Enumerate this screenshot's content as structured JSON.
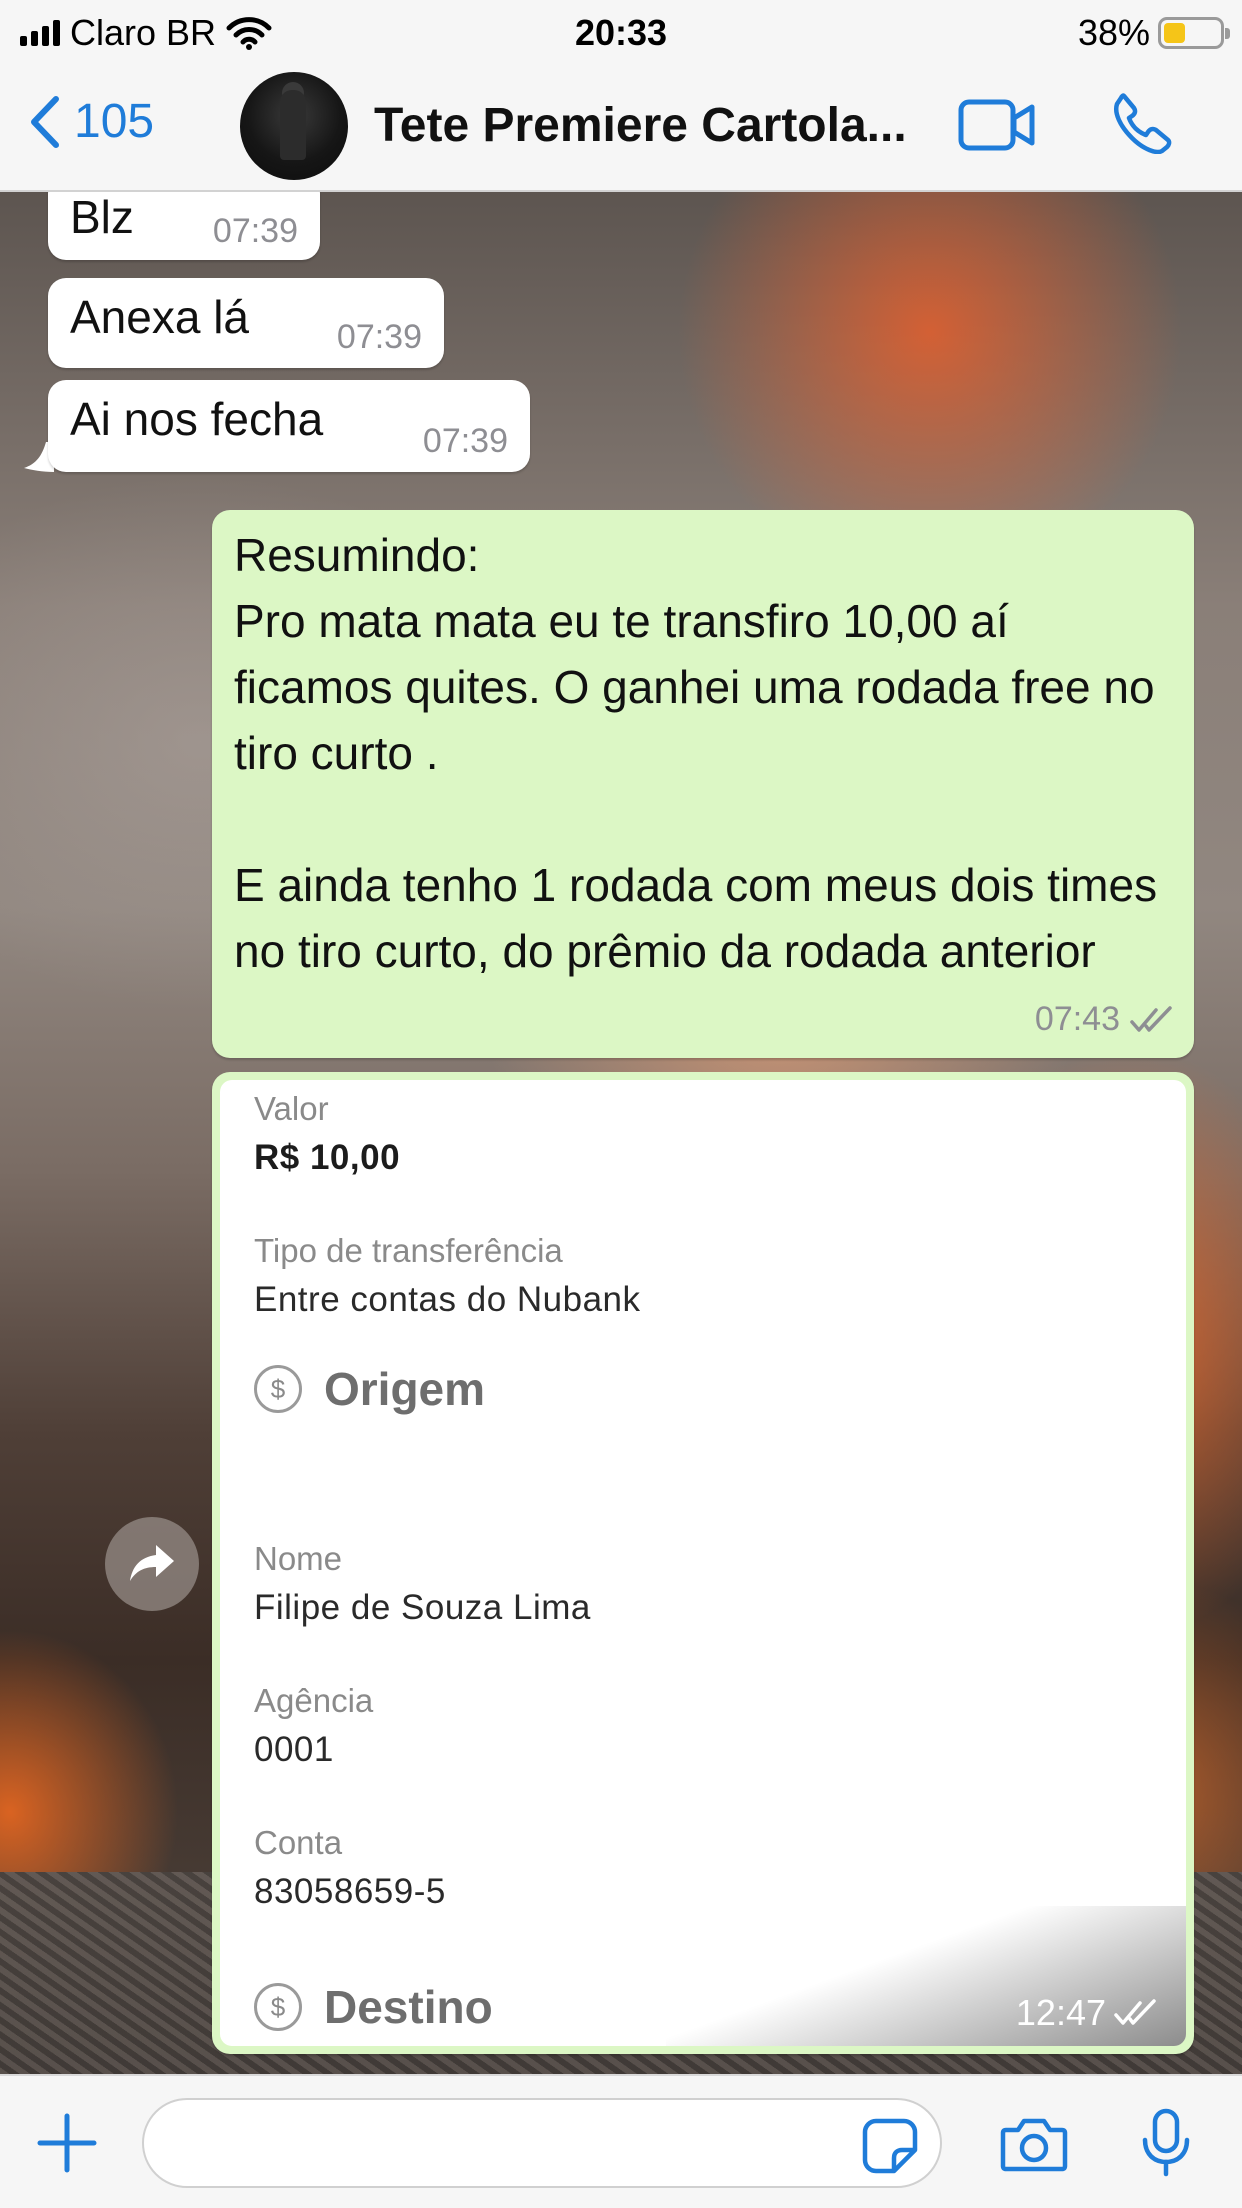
{
  "status_bar": {
    "carrier": "Claro BR",
    "time": "20:33",
    "battery": "38%",
    "battery_level": 0.38
  },
  "header": {
    "back_count": "105",
    "chat_title": "Tete Premiere Cartola...",
    "icons": [
      "chevron-left-icon",
      "video-camera-icon",
      "phone-icon"
    ]
  },
  "messages": [
    {
      "direction": "incoming",
      "text": "Blz",
      "time": "07:39"
    },
    {
      "direction": "incoming",
      "text": "Anexa lá",
      "time": "07:39"
    },
    {
      "direction": "incoming",
      "text": "Ai nos fecha",
      "time": "07:39"
    },
    {
      "direction": "outgoing",
      "text": "Resumindo:\nPro mata mata eu te transfiro 10,00 aí ficamos quites. O ganhei uma rodada free no tiro curto .\n\nE ainda tenho 1 rodada com meus dois times no tiro curto, do prêmio da rodada anterior",
      "time": "07:43",
      "status": "read"
    }
  ],
  "receipt": {
    "time": "12:47",
    "valor_label": "Valor",
    "valor": "R$ 10,00",
    "tipo_label": "Tipo de transferência",
    "tipo": "Entre contas do Nubank",
    "origem_title": "Origem",
    "nome_label": "Nome",
    "nome": "Filipe de Souza Lima",
    "agencia_label": "Agência",
    "agencia": "0001",
    "conta_label": "Conta",
    "conta": "83058659-5",
    "destino_title": "Destino",
    "coin_symbol": "$"
  },
  "input": {
    "placeholder": ""
  },
  "colors": {
    "accent": "#1f7cd9",
    "outgoing_bubble": "#dcf7c5",
    "incoming_bubble": "#ffffff",
    "read_ticks": "#8e8e93"
  }
}
